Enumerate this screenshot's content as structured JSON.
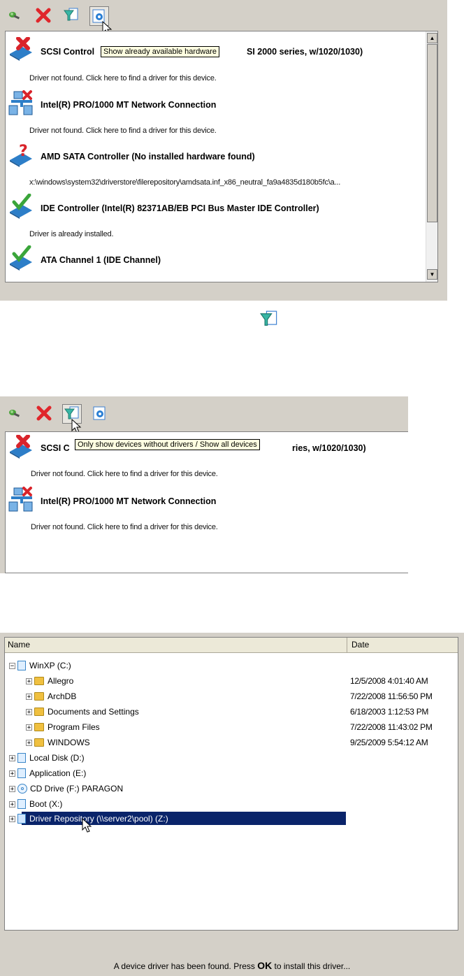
{
  "screen1": {
    "toolbar": {
      "add_icon": "add-driver-icon",
      "remove_icon": "remove-icon",
      "filter_icon": "filter-icon",
      "hardware_icon": "show-hardware-icon"
    },
    "tooltip": "Show already available hardware",
    "devices": [
      {
        "title": "SCSI Control",
        "title_tail": "SI 2000 series, w/1020/1030)",
        "desc": "Driver not found. Click here to find a driver for this device.",
        "status": "error"
      },
      {
        "title": "Intel(R) PRO/1000 MT Network Connection",
        "desc": "Driver not found. Click here to find a driver for this device.",
        "status": "network-error"
      },
      {
        "title": "AMD SATA Controller (No installed hardware found)",
        "desc": "x:\\windows\\system32\\driverstore\\filerepository\\amdsata.inf_x86_neutral_fa9a4835d180b5fc\\a...",
        "status": "unknown"
      },
      {
        "title": "IDE Controller (Intel(R) 82371AB/EB PCI Bus Master IDE Controller)",
        "desc": "Driver is already installed.",
        "status": "ok"
      },
      {
        "title": "ATA Channel 1 (IDE Channel)",
        "desc": "",
        "status": "ok"
      }
    ]
  },
  "screen2": {
    "tooltip": "Only show devices without drivers / Show all devices",
    "devices": [
      {
        "title": "SCSI C",
        "title_tail": "ries, w/1020/1030)",
        "desc": "Driver not found. Click here to find a driver for this device."
      },
      {
        "title": "Intel(R) PRO/1000 MT Network Connection",
        "desc": "Driver not found. Click here to find a driver for this device."
      }
    ]
  },
  "screen3": {
    "columns": {
      "name": "Name",
      "date": "Date"
    },
    "tree": [
      {
        "label": "WinXP (C:)",
        "type": "drive",
        "expanded": true,
        "level": 0,
        "date": ""
      },
      {
        "label": "Allegro",
        "type": "folder",
        "level": 1,
        "date": "12/5/2008 4:01:40 AM"
      },
      {
        "label": "ArchDB",
        "type": "folder",
        "level": 1,
        "date": "7/22/2008 11:56:50 PM"
      },
      {
        "label": "Documents and Settings",
        "type": "folder",
        "level": 1,
        "date": "6/18/2003 1:12:53 PM"
      },
      {
        "label": "Program Files",
        "type": "folder",
        "level": 1,
        "date": "7/22/2008 11:43:02 PM"
      },
      {
        "label": "WINDOWS",
        "type": "folder",
        "level": 1,
        "date": "9/25/2009 5:54:12 AM"
      },
      {
        "label": "Local Disk (D:)",
        "type": "drive",
        "level": 0,
        "date": ""
      },
      {
        "label": "Application (E:)",
        "type": "drive",
        "level": 0,
        "date": ""
      },
      {
        "label": "CD Drive (F:) PARAGON",
        "type": "cd",
        "level": 0,
        "date": ""
      },
      {
        "label": "Boot (X:)",
        "type": "drive",
        "level": 0,
        "date": ""
      },
      {
        "label": "Driver Repository (\\\\server2\\pool) (Z:)",
        "type": "drive",
        "level": 0,
        "date": "",
        "selected": true
      }
    ],
    "status_pre": "A device driver has been found. Press ",
    "status_bold": "OK",
    "status_post": " to install this driver..."
  },
  "colors": {
    "selection": "#0a246a",
    "panel": "#d4d0c8",
    "error_red": "#d9232a",
    "ok_green": "#3aa53a",
    "accent_blue": "#2a7fd4"
  }
}
